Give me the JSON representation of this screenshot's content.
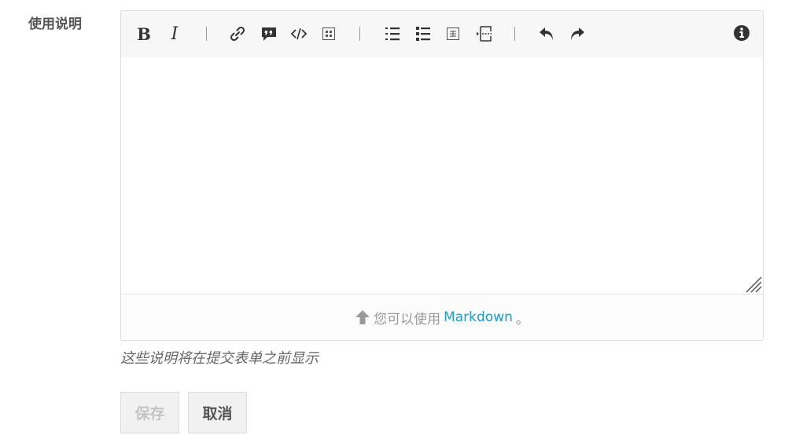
{
  "field": {
    "label": "使用说明"
  },
  "toolbar": {
    "bold": "B",
    "italic": "I",
    "icons": [
      "bold-icon",
      "italic-icon",
      "link-icon",
      "blockquote-icon",
      "code-icon",
      "image-icon",
      "numbered-list-icon",
      "bulleted-list-icon",
      "table-icon",
      "horizontal-rule-icon",
      "undo-icon",
      "redo-icon",
      "info-icon"
    ]
  },
  "editor": {
    "value": ""
  },
  "footer": {
    "prefix": "您可以使用",
    "link": "Markdown",
    "suffix": "。"
  },
  "help_text": "这些说明将在提交表单之前显示",
  "buttons": {
    "save": "保存",
    "cancel": "取消"
  },
  "colors": {
    "link": "#1a9bc4",
    "toolbar_bg": "#f7f7f7",
    "border": "#dddddd"
  }
}
